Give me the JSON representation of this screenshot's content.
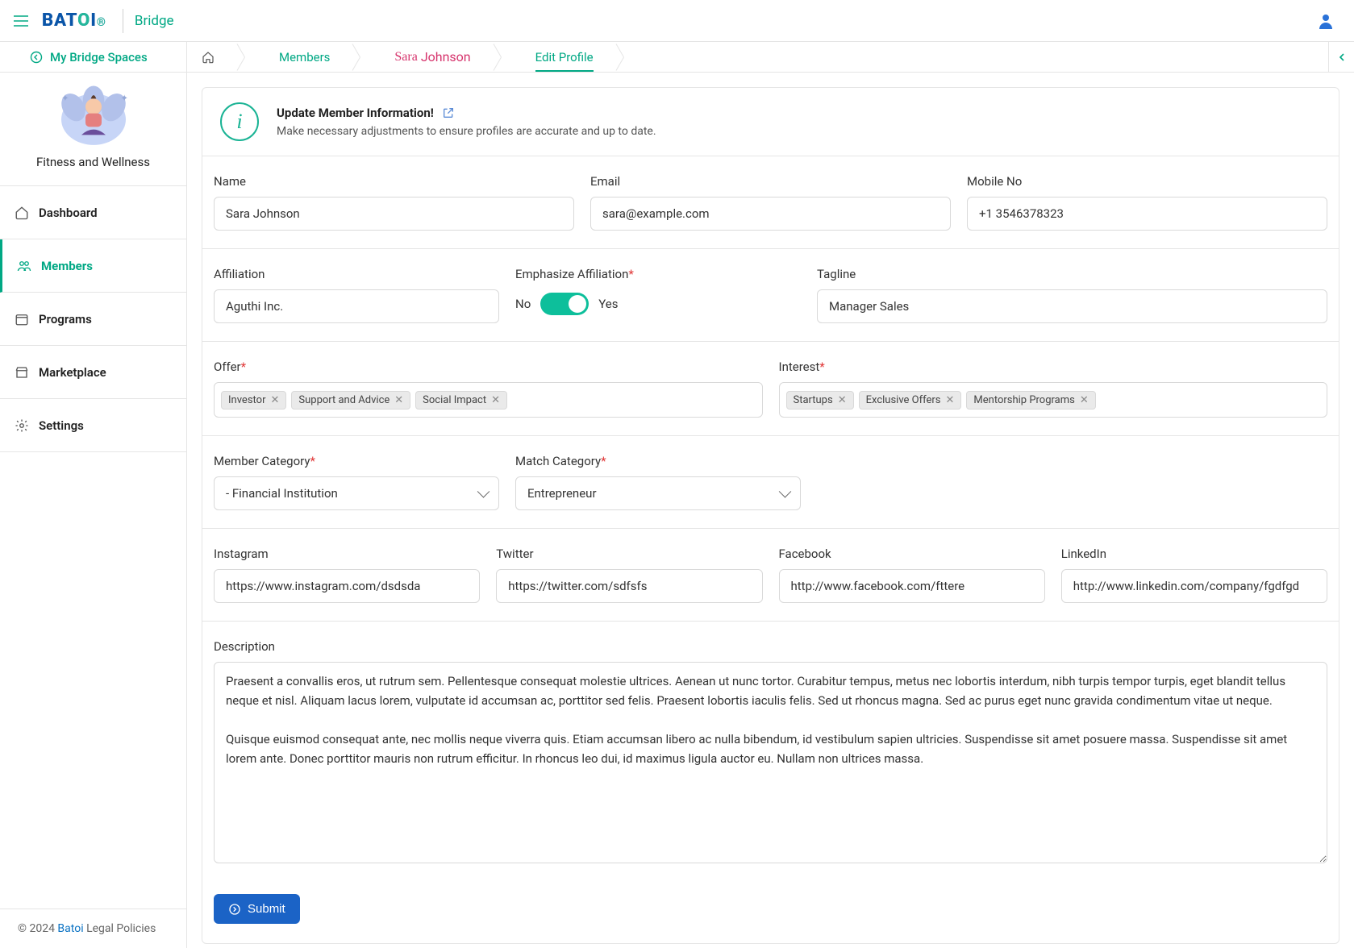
{
  "header": {
    "brand_main": "BAT",
    "brand_o": "O",
    "brand_i": "I",
    "bridge": "Bridge"
  },
  "subheader": {
    "my_spaces": "My Bridge Spaces"
  },
  "breadcrumbs": {
    "members": "Members",
    "sara_first": "Sara",
    "sara_last": "Johnson",
    "edit": "Edit Profile"
  },
  "sidebar": {
    "space_name": "Fitness and Wellness",
    "items": [
      {
        "label": "Dashboard"
      },
      {
        "label": "Members"
      },
      {
        "label": "Programs"
      },
      {
        "label": "Marketplace"
      },
      {
        "label": "Settings"
      }
    ]
  },
  "footer": {
    "copyright_prefix": "© 2024 ",
    "brand": "Batoi",
    "suffix": " Legal Policies"
  },
  "info": {
    "title": "Update Member Information!",
    "desc": "Make necessary adjustments to ensure profiles are accurate and up to date."
  },
  "form": {
    "name": {
      "label": "Name",
      "value": "Sara Johnson"
    },
    "email": {
      "label": "Email",
      "value": "sara@example.com"
    },
    "mobile": {
      "label": "Mobile No",
      "value": "+1 3546378323"
    },
    "affiliation": {
      "label": "Affiliation",
      "value": "Aguthi Inc."
    },
    "emphasize": {
      "label": "Emphasize Affiliation",
      "no": "No",
      "yes": "Yes"
    },
    "tagline": {
      "label": "Tagline",
      "value": "Manager Sales"
    },
    "offer": {
      "label": "Offer",
      "tags": [
        "Investor",
        "Support and Advice",
        "Social Impact"
      ]
    },
    "interest": {
      "label": "Interest",
      "tags": [
        "Startups",
        "Exclusive Offers",
        "Mentorship Programs"
      ]
    },
    "member_category": {
      "label": "Member Category",
      "value": "- Financial Institution"
    },
    "match_category": {
      "label": "Match Category",
      "value": "Entrepreneur"
    },
    "instagram": {
      "label": "Instagram",
      "value": "https://www.instagram.com/dsdsda"
    },
    "twitter": {
      "label": "Twitter",
      "value": "https://twitter.com/sdfsfs"
    },
    "facebook": {
      "label": "Facebook",
      "value": "http://www.facebook.com/fttere"
    },
    "linkedin": {
      "label": "LinkedIn",
      "value": "http://www.linkedin.com/company/fgdfgd"
    },
    "description": {
      "label": "Description",
      "value": "Praesent a convallis eros, ut rutrum sem. Pellentesque consequat molestie ultrices. Aenean ut nunc tortor. Curabitur tempus, metus nec lobortis interdum, nibh turpis tempor turpis, eget blandit tellus neque et nisl. Aliquam lacus lorem, vulputate id accumsan ac, porttitor sed felis. Praesent lobortis iaculis felis. Sed ut rhoncus magna. Sed ac purus eget nunc gravida condimentum vitae ut neque.\n\nQuisque euismod consequat ante, nec mollis neque viverra quis. Etiam accumsan libero ac nulla bibendum, id vestibulum sapien ultricies. Suspendisse sit amet posuere massa. Suspendisse sit amet lorem ante. Donec porttitor mauris non rutrum efficitur. In rhoncus leo dui, id maximus ligula auctor eu. Nullam non ultrices massa."
    },
    "submit": "Submit"
  }
}
